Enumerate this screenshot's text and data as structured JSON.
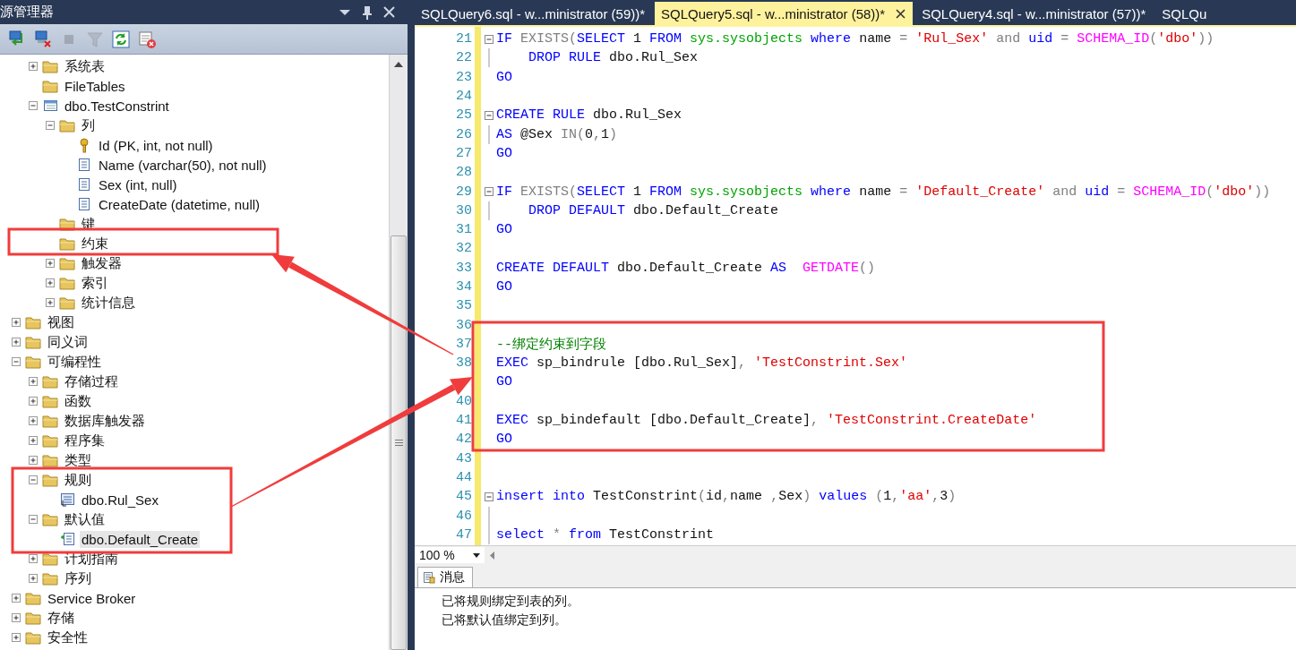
{
  "explorer": {
    "title": "源管理器",
    "toolbar": [
      {
        "kind": "connect",
        "disabled": false
      },
      {
        "kind": "disconnect",
        "disabled": false
      },
      {
        "kind": "stop",
        "disabled": true
      },
      {
        "kind": "filter",
        "disabled": true
      },
      {
        "kind": "refresh",
        "disabled": false
      },
      {
        "kind": "delete",
        "disabled": false
      }
    ],
    "tree": {
      "continued_children": [
        {
          "label": "系统表",
          "kind": "folder",
          "expanded": false,
          "selected": false
        },
        {
          "label": "FileTables",
          "kind": "folder",
          "selected": false
        },
        {
          "label": "dbo.TestConstrint",
          "kind": "table",
          "expanded": true,
          "selected": false,
          "children": [
            {
              "label": "列",
              "kind": "folder",
              "expanded": true,
              "selected": false,
              "children": [
                {
                  "label": "Id (PK, int, not null)",
                  "kind": "key",
                  "selected": false
                },
                {
                  "label": "Name (varchar(50), not null)",
                  "kind": "column",
                  "selected": false
                },
                {
                  "label": "Sex (int, null)",
                  "kind": "column",
                  "selected": false
                },
                {
                  "label": "CreateDate (datetime, null)",
                  "kind": "column",
                  "selected": false
                }
              ]
            },
            {
              "label": "键",
              "kind": "folder",
              "selected": false
            },
            {
              "label": "约束",
              "kind": "folder",
              "selected": false
            },
            {
              "label": "触发器",
              "kind": "folder",
              "expanded": false,
              "selected": false
            },
            {
              "label": "索引",
              "kind": "folder",
              "expanded": false,
              "selected": false
            },
            {
              "label": "统计信息",
              "kind": "folder",
              "expanded": false,
              "selected": false
            }
          ]
        }
      ],
      "items": [
        {
          "label": "视图",
          "kind": "folder",
          "expanded": false,
          "selected": false
        },
        {
          "label": "同义词",
          "kind": "folder",
          "expanded": false,
          "selected": false
        },
        {
          "label": "可编程性",
          "kind": "folder",
          "expanded": true,
          "selected": false,
          "children": [
            {
              "label": "存储过程",
              "kind": "folder",
              "expanded": false,
              "selected": false
            },
            {
              "label": "函数",
              "kind": "folder",
              "expanded": false,
              "selected": false
            },
            {
              "label": "数据库触发器",
              "kind": "folder",
              "expanded": false,
              "selected": false
            },
            {
              "label": "程序集",
              "kind": "folder",
              "expanded": false,
              "selected": false
            },
            {
              "label": "类型",
              "kind": "folder",
              "expanded": false,
              "selected": false
            },
            {
              "label": "规则",
              "kind": "folder",
              "expanded": true,
              "selected": false,
              "children": [
                {
                  "label": "dbo.Rul_Sex",
                  "kind": "rule",
                  "selected": false
                }
              ]
            },
            {
              "label": "默认值",
              "kind": "folder",
              "expanded": true,
              "selected": false,
              "children": [
                {
                  "label": "dbo.Default_Create",
                  "kind": "default",
                  "selected": true
                }
              ]
            },
            {
              "label": "计划指南",
              "kind": "folder",
              "expanded": false,
              "selected": false
            },
            {
              "label": "序列",
              "kind": "folder",
              "expanded": false,
              "selected": false
            }
          ]
        },
        {
          "label": "Service Broker",
          "kind": "folder",
          "expanded": false,
          "selected": false
        },
        {
          "label": "存储",
          "kind": "folder",
          "expanded": false,
          "selected": false
        },
        {
          "label": "安全性",
          "kind": "folder",
          "expanded": false,
          "selected": false
        }
      ]
    }
  },
  "tabs": [
    {
      "label": "SQLQuery6.sql - w...ministrator (59))*",
      "selected": false
    },
    {
      "label": "SQLQuery5.sql - w...ministrator (58))*",
      "selected": true
    },
    {
      "label": "SQLQuery4.sql - w...ministrator (57))*",
      "selected": false
    },
    {
      "label": "SQLQu",
      "selected": false
    }
  ],
  "editor": {
    "lines": [
      {
        "number": "21",
        "fold_box": true,
        "tokens": [
          {
            "kind": "keyword",
            "text": "IF"
          },
          {
            "kind": "operator",
            "text": " EXISTS("
          },
          {
            "kind": "keyword",
            "text": "SELECT"
          },
          {
            "kind": "plain",
            "text": " 1 "
          },
          {
            "kind": "keyword",
            "text": "FROM"
          },
          {
            "kind": "system",
            "text": " sys.sysobjects"
          },
          {
            "kind": "keyword",
            "text": " where"
          },
          {
            "kind": "plain",
            "text": " name "
          },
          {
            "kind": "operator",
            "text": "="
          },
          {
            "kind": "string",
            "text": " 'Rul_Sex'"
          },
          {
            "kind": "operator",
            "text": " and"
          },
          {
            "kind": "keyword",
            "text": " uid"
          },
          {
            "kind": "operator",
            "text": " ="
          },
          {
            "kind": "function",
            "text": " SCHEMA_ID"
          },
          {
            "kind": "operator",
            "text": "("
          },
          {
            "kind": "string",
            "text": "'dbo'"
          },
          {
            "kind": "operator",
            "text": "))"
          }
        ]
      },
      {
        "number": "22",
        "fold_line": true,
        "tokens": [
          {
            "kind": "keyword",
            "text": "    DROP RULE"
          },
          {
            "kind": "plain",
            "text": " dbo.Rul_Sex"
          }
        ]
      },
      {
        "number": "23",
        "tokens": [
          {
            "kind": "keyword",
            "text": "GO"
          }
        ]
      },
      {
        "number": "24"
      },
      {
        "number": "25",
        "fold_box": true,
        "tokens": [
          {
            "kind": "keyword",
            "text": "CREATE RULE"
          },
          {
            "kind": "plain",
            "text": " dbo.Rul_Sex"
          }
        ]
      },
      {
        "number": "26",
        "fold_line": true,
        "tokens": [
          {
            "kind": "keyword",
            "text": "AS"
          },
          {
            "kind": "plain",
            "text": " @Sex "
          },
          {
            "kind": "operator",
            "text": "IN("
          },
          {
            "kind": "plain",
            "text": "0"
          },
          {
            "kind": "operator",
            "text": ","
          },
          {
            "kind": "plain",
            "text": "1"
          },
          {
            "kind": "operator",
            "text": ")"
          }
        ]
      },
      {
        "number": "27",
        "tokens": [
          {
            "kind": "keyword",
            "text": "GO"
          }
        ]
      },
      {
        "number": "28"
      },
      {
        "number": "29",
        "fold_box": true,
        "tokens": [
          {
            "kind": "keyword",
            "text": "IF"
          },
          {
            "kind": "operator",
            "text": " EXISTS("
          },
          {
            "kind": "keyword",
            "text": "SELECT"
          },
          {
            "kind": "plain",
            "text": " 1 "
          },
          {
            "kind": "keyword",
            "text": "FROM"
          },
          {
            "kind": "system",
            "text": " sys.sysobjects"
          },
          {
            "kind": "keyword",
            "text": " where"
          },
          {
            "kind": "plain",
            "text": " name "
          },
          {
            "kind": "operator",
            "text": "="
          },
          {
            "kind": "string",
            "text": " 'Default_Create'"
          },
          {
            "kind": "operator",
            "text": " and"
          },
          {
            "kind": "keyword",
            "text": " uid"
          },
          {
            "kind": "operator",
            "text": " ="
          },
          {
            "kind": "function",
            "text": " SCHEMA_ID"
          },
          {
            "kind": "operator",
            "text": "("
          },
          {
            "kind": "string",
            "text": "'dbo'"
          },
          {
            "kind": "operator",
            "text": "))"
          }
        ]
      },
      {
        "number": "30",
        "fold_line": true,
        "tokens": [
          {
            "kind": "keyword",
            "text": "    DROP DEFAULT"
          },
          {
            "kind": "plain",
            "text": " dbo.Default_Create"
          }
        ]
      },
      {
        "number": "31",
        "tokens": [
          {
            "kind": "keyword",
            "text": "GO"
          }
        ]
      },
      {
        "number": "32"
      },
      {
        "number": "33",
        "tokens": [
          {
            "kind": "keyword",
            "text": "CREATE DEFAULT"
          },
          {
            "kind": "plain",
            "text": " dbo.Default_Create "
          },
          {
            "kind": "keyword",
            "text": "AS"
          },
          {
            "kind": "function",
            "text": "  GETDATE"
          },
          {
            "kind": "operator",
            "text": "()"
          }
        ]
      },
      {
        "number": "34",
        "tokens": [
          {
            "kind": "keyword",
            "text": "GO"
          }
        ]
      },
      {
        "number": "35"
      },
      {
        "number": "36"
      },
      {
        "number": "37",
        "tokens": [
          {
            "kind": "comment",
            "text": "--绑定约束到字段"
          }
        ]
      },
      {
        "number": "38",
        "tokens": [
          {
            "kind": "keyword",
            "text": "EXEC"
          },
          {
            "kind": "plain",
            "text": " sp_bindrule [dbo.Rul_Sex]"
          },
          {
            "kind": "operator",
            "text": ","
          },
          {
            "kind": "string",
            "text": " 'TestConstrint.Sex'"
          }
        ]
      },
      {
        "tokens": [
          {
            "kind": "keyword",
            "text": "GO"
          }
        ]
      },
      {
        "number": "40"
      },
      {
        "number": "41",
        "tokens": [
          {
            "kind": "keyword",
            "text": "EXEC"
          },
          {
            "kind": "plain",
            "text": " sp_bindefault [dbo.Default_Create]"
          },
          {
            "kind": "operator",
            "text": ","
          },
          {
            "kind": "string",
            "text": " 'TestConstrint.CreateDate'"
          }
        ]
      },
      {
        "number": "42",
        "tokens": [
          {
            "kind": "keyword",
            "text": "GO"
          }
        ]
      },
      {
        "number": "43"
      },
      {
        "number": "44"
      },
      {
        "number": "45",
        "fold_box": true,
        "tokens": [
          {
            "kind": "keyword",
            "text": "insert into"
          },
          {
            "kind": "plain",
            "text": " TestConstrint"
          },
          {
            "kind": "operator",
            "text": "("
          },
          {
            "kind": "plain",
            "text": "id"
          },
          {
            "kind": "operator",
            "text": ","
          },
          {
            "kind": "plain",
            "text": "name "
          },
          {
            "kind": "operator",
            "text": ","
          },
          {
            "kind": "plain",
            "text": "Sex"
          },
          {
            "kind": "operator",
            "text": ")"
          },
          {
            "kind": "keyword",
            "text": " values"
          },
          {
            "kind": "operator",
            "text": " ("
          },
          {
            "kind": "plain",
            "text": "1"
          },
          {
            "kind": "operator",
            "text": ","
          },
          {
            "kind": "string",
            "text": "'aa'"
          },
          {
            "kind": "operator",
            "text": ","
          },
          {
            "kind": "plain",
            "text": "3"
          },
          {
            "kind": "operator",
            "text": ")"
          }
        ]
      },
      {
        "number": "46",
        "fold_line": true
      },
      {
        "number": "47",
        "fold_line": true,
        "tokens": [
          {
            "kind": "keyword",
            "text": "select"
          },
          {
            "kind": "operator",
            "text": " * "
          },
          {
            "kind": "keyword",
            "text": "from"
          },
          {
            "kind": "plain",
            "text": " TestConstrint"
          }
        ]
      }
    ],
    "zoom": "100 %"
  },
  "messages": {
    "tab": "消息",
    "lines": [
      "已将规则绑定到表的列。",
      "已将默认值绑定到列。"
    ]
  }
}
